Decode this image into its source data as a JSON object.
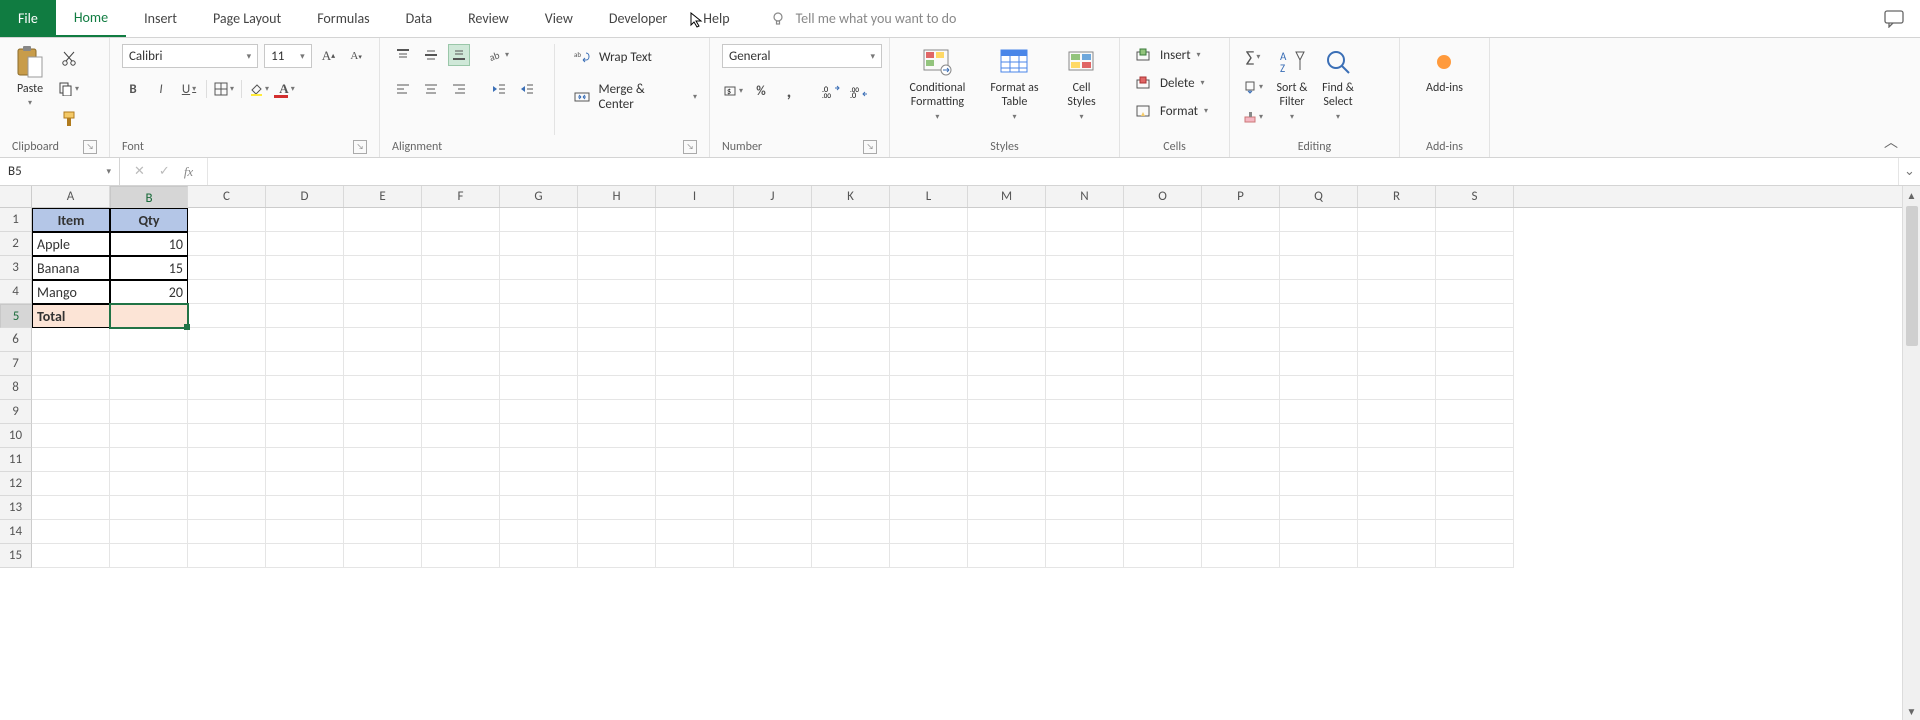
{
  "tabs": {
    "file": "File",
    "home": "Home",
    "insert": "Insert",
    "page_layout": "Page Layout",
    "formulas": "Formulas",
    "data": "Data",
    "review": "Review",
    "view": "View",
    "developer": "Developer",
    "help": "Help",
    "tell_me": "Tell me what you want to do"
  },
  "ribbon": {
    "clipboard": {
      "paste": "Paste",
      "label": "Clipboard"
    },
    "font": {
      "name": "Calibri",
      "size": "11",
      "label": "Font",
      "bold": "B",
      "italic": "I",
      "underline": "U"
    },
    "alignment": {
      "wrap": "Wrap Text",
      "merge": "Merge & Center",
      "label": "Alignment"
    },
    "number": {
      "format": "General",
      "label": "Number",
      "percent": "%",
      "comma": ","
    },
    "styles": {
      "cond": "Conditional\nFormatting",
      "table": "Format as\nTable",
      "cell": "Cell\nStyles",
      "label": "Styles"
    },
    "cells": {
      "insert": "Insert",
      "delete": "Delete",
      "format": "Format",
      "label": "Cells"
    },
    "editing": {
      "sort": "Sort &\nFilter",
      "find": "Find &\nSelect",
      "label": "Editing"
    },
    "addins": {
      "btn": "Add-ins",
      "label": "Add-ins"
    }
  },
  "formula_bar": {
    "name": "B5",
    "fx": "fx"
  },
  "columns": [
    "A",
    "B",
    "C",
    "D",
    "E",
    "F",
    "G",
    "H",
    "I",
    "J",
    "K",
    "L",
    "M",
    "N",
    "O",
    "P",
    "Q",
    "R",
    "S"
  ],
  "rows": [
    "1",
    "2",
    "3",
    "4",
    "5",
    "6",
    "7",
    "8",
    "9",
    "10",
    "11",
    "12",
    "13",
    "14",
    "15"
  ],
  "chart_data": {
    "type": "table",
    "headers": [
      "Item",
      "Qty"
    ],
    "rows": [
      {
        "item": "Apple",
        "qty": "10"
      },
      {
        "item": "Banana",
        "qty": "15"
      },
      {
        "item": "Mango",
        "qty": "20"
      }
    ],
    "total_label": "Total",
    "total_value": ""
  }
}
